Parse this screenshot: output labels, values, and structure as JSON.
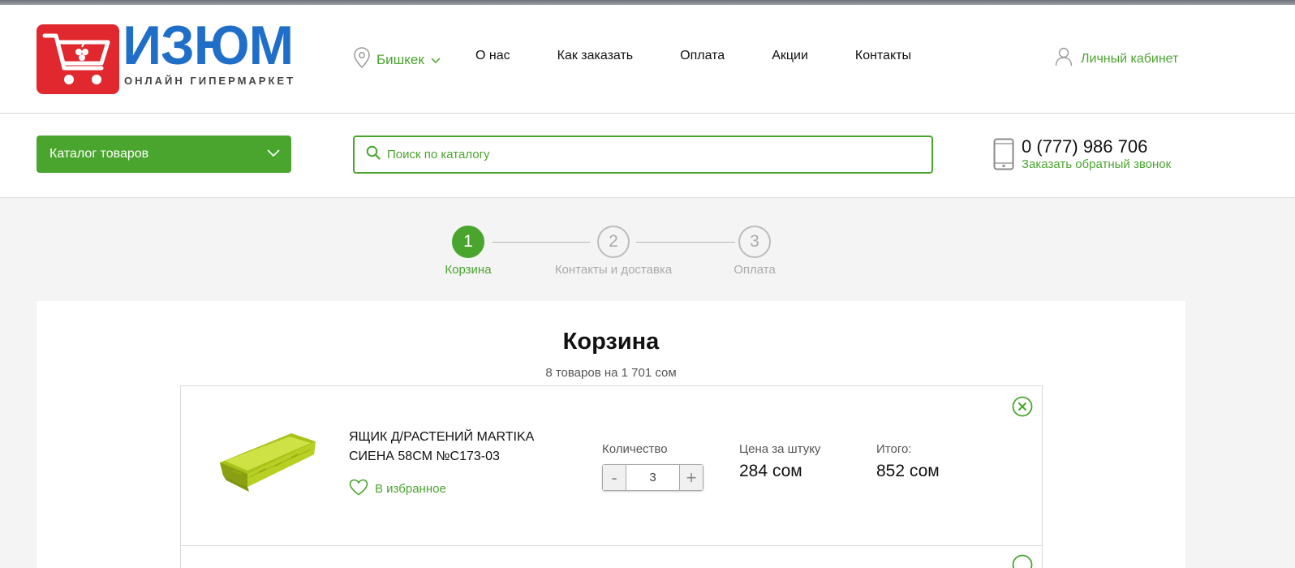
{
  "brand": {
    "name": "ИЗЮМ",
    "tagline": "ОНЛАЙН ГИПЕРМАРКЕТ",
    "red": "#e0282e",
    "blue": "#1f6fc8",
    "accent_green": "#4aa52e"
  },
  "header": {
    "city": "Бишкек",
    "nav": [
      "О нас",
      "Как заказать",
      "Оплата",
      "Акции",
      "Контакты"
    ],
    "account": "Личный кабинет"
  },
  "toolbar": {
    "catalog_label": "Каталог товаров",
    "search_placeholder": "Поиск по каталогу",
    "phone": "0 (777) 986 706",
    "callback": "Заказать обратный звонок"
  },
  "steps": [
    {
      "number": "1",
      "label": "Корзина",
      "active": true
    },
    {
      "number": "2",
      "label": "Контакты и доставка",
      "active": false
    },
    {
      "number": "3",
      "label": "Оплата",
      "active": false
    }
  ],
  "cart": {
    "title": "Корзина",
    "summary": "8 товаров на 1 701 сом",
    "items": [
      {
        "name": "ЯЩИК Д/РАСТЕНИЙ MARTIKA СИЕНА 58СМ №С173-03",
        "favorite_label": "В избранное",
        "quantity_label": "Количество",
        "quantity": "3",
        "minus": "-",
        "plus": "+",
        "price_label": "Цена за штуку",
        "price": "284 сом",
        "total_label": "Итого:",
        "total": "852 сом",
        "image_icon": "planter-box-image"
      }
    ]
  },
  "icons": {
    "location": "location-pin-icon",
    "chevron": "chevron-down-icon",
    "user": "user-icon",
    "search": "search-icon",
    "phone": "mobile-phone-icon",
    "heart": "heart-icon",
    "remove": "close-circle-icon"
  }
}
